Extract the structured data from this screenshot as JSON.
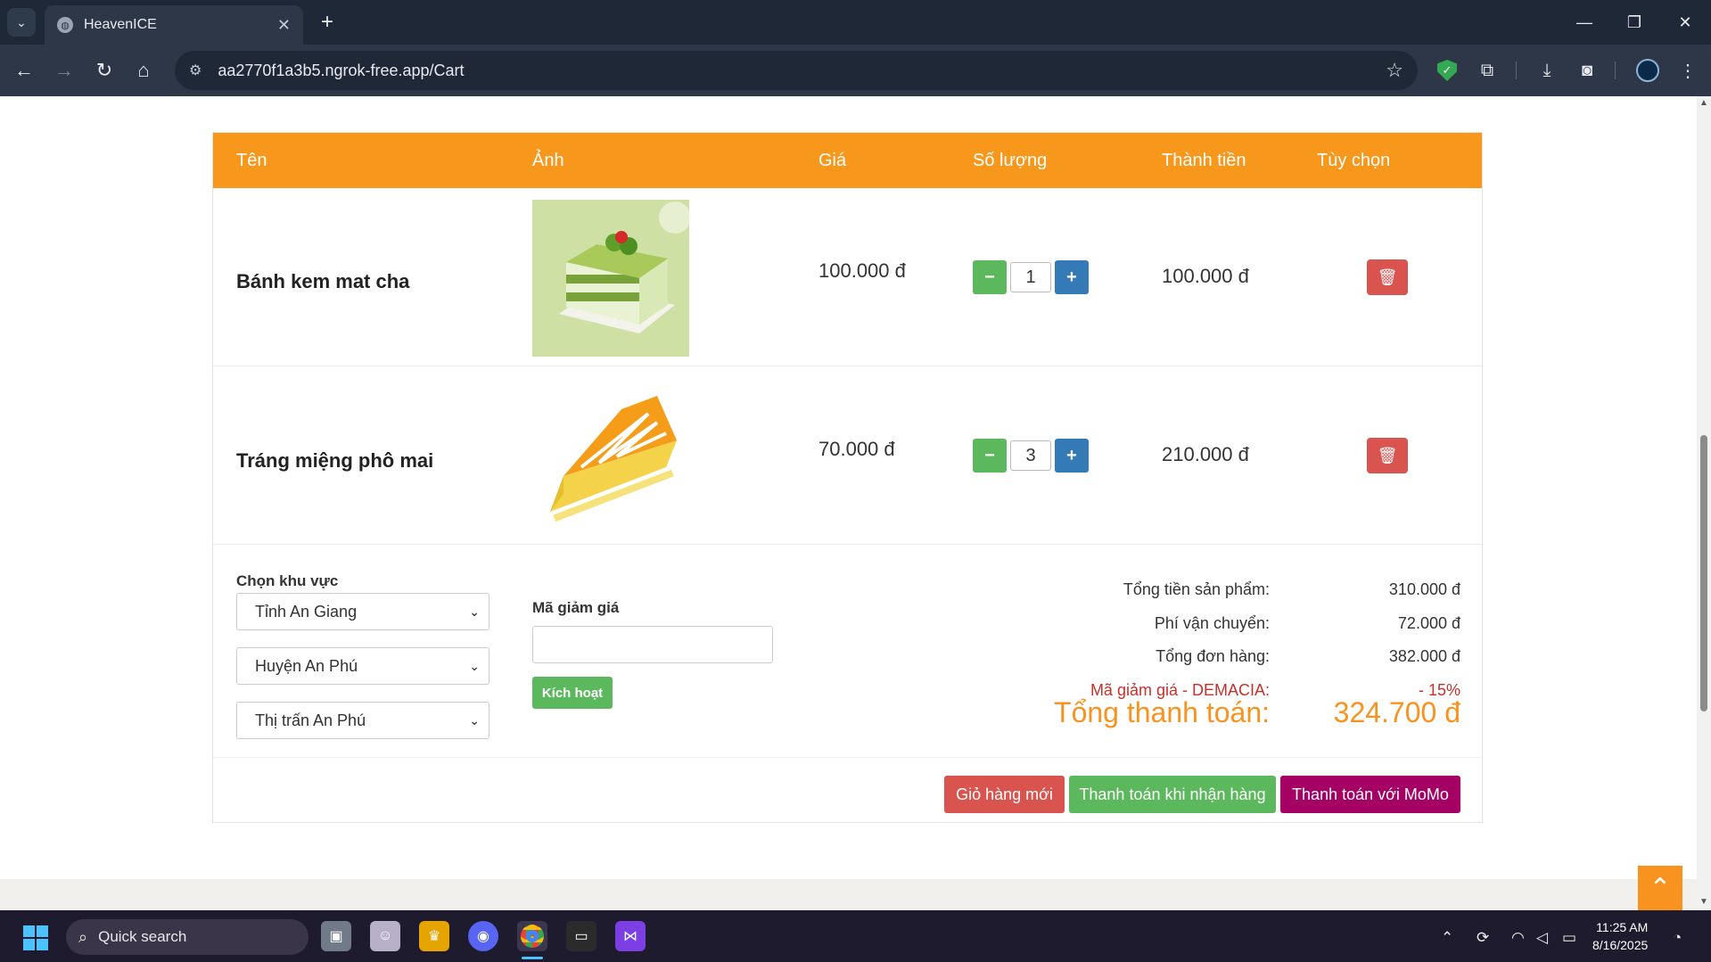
{
  "browser": {
    "tab_title": "HeavenICE",
    "url": "aa2770f1a3b5.ngrok-free.app/Cart"
  },
  "cart": {
    "columns": [
      "Tên",
      "Ảnh",
      "Giá",
      "Số lượng",
      "Thành tiền",
      "Tùy chọn"
    ],
    "items": [
      {
        "name": "Bánh kem mat cha",
        "price": "100.000 đ",
        "quantity": "1",
        "subtotal": "100.000 đ",
        "image": "matcha-cake"
      },
      {
        "name": "Tráng miệng phô mai",
        "price": "70.000 đ",
        "quantity": "3",
        "subtotal": "210.000 đ",
        "image": "cheesecake-slice"
      }
    ],
    "region": {
      "label": "Chọn khu vực",
      "province": "Tỉnh An Giang",
      "district": "Huyện An Phú",
      "ward": "Thị trấn An Phú"
    },
    "voucher": {
      "label": "Mã giảm giá",
      "value": "",
      "activate_label": "Kích hoạt"
    },
    "summary": {
      "products_label": "Tổng tiền sản phẩm:",
      "products_value": "310.000 đ",
      "shipping_label": "Phí vận chuyển:",
      "shipping_value": "72.000 đ",
      "order_label": "Tổng đơn hàng:",
      "order_value": "382.000 đ",
      "discount_label": "Mã giảm giá - DEMACIA:",
      "discount_value": "- 15%",
      "total_label": "Tổng thanh toán:",
      "total_value": "324.700 đ"
    },
    "actions": {
      "new_cart": "Giỏ hàng mới",
      "cod": "Thanh toán khi nhận hàng",
      "momo": "Thanh toán với MoMo"
    }
  },
  "taskbar": {
    "search_label": "Quick search",
    "time": "11:25 AM",
    "date": "8/16/2025"
  },
  "colors": {
    "accent": "#f7971c",
    "success": "#5cb85c",
    "danger": "#d9534f",
    "primary": "#337ab7",
    "momo": "#a50064"
  }
}
